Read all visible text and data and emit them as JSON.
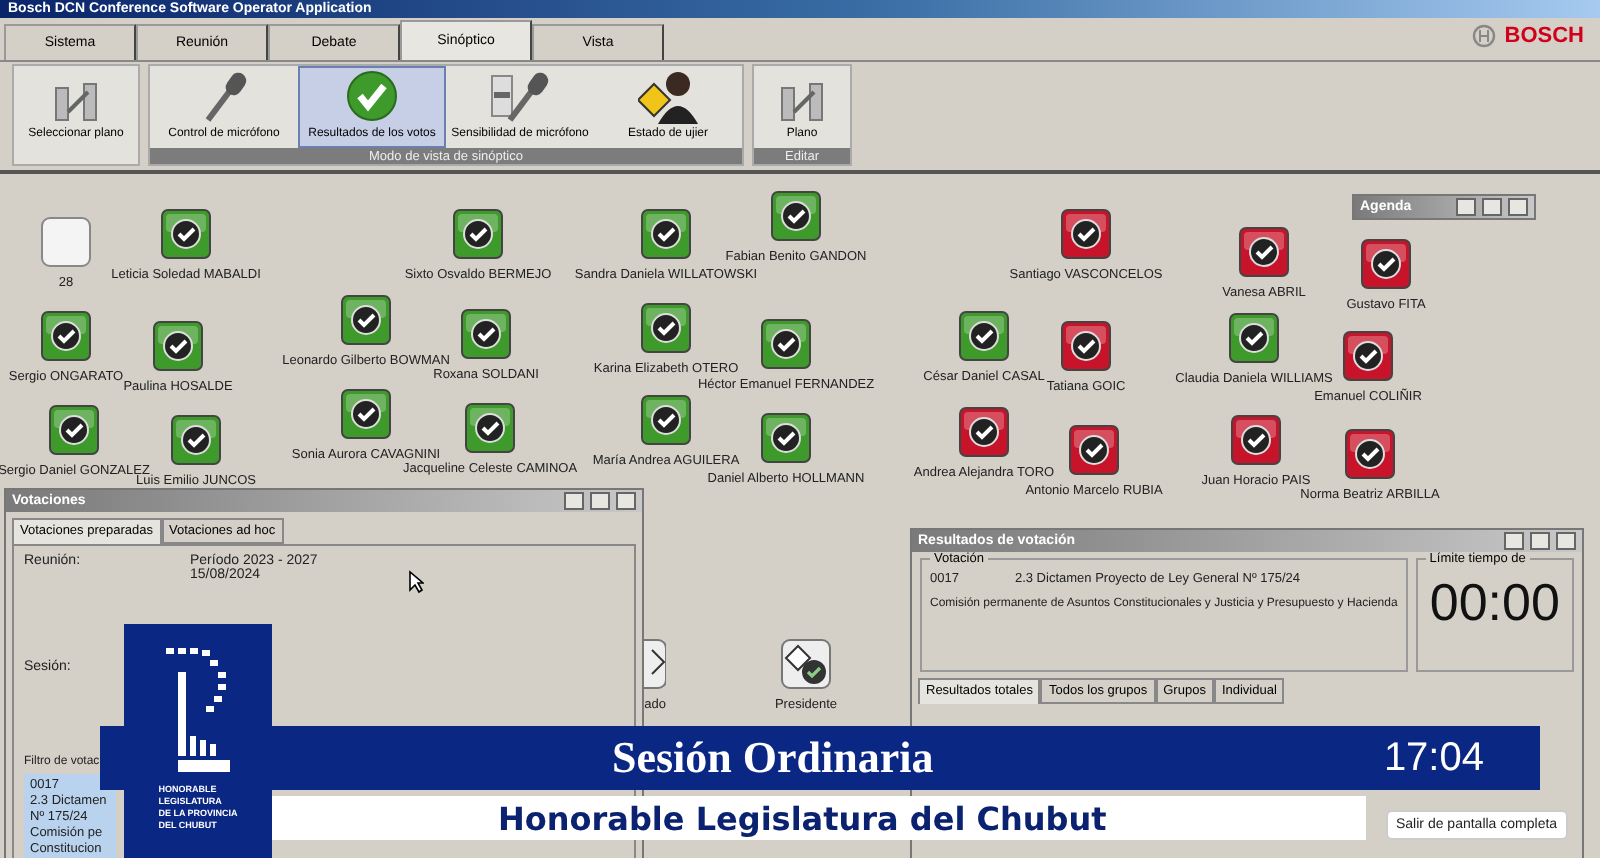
{
  "window": {
    "title": "Bosch DCN Conference Software Operator Application",
    "brand": "BOSCH"
  },
  "tabs": [
    {
      "label": "Sistema",
      "selected": false
    },
    {
      "label": "Reunión",
      "selected": false
    },
    {
      "label": "Debate",
      "selected": false
    },
    {
      "label": "Sinóptico",
      "selected": true
    },
    {
      "label": "Vista",
      "selected": false
    }
  ],
  "ribbon": {
    "plan_selector": {
      "label": "Seleccionar plano"
    },
    "groups": [
      {
        "label": "Modo de vista de sinóptico",
        "buttons": [
          {
            "label": "Control de micrófono",
            "kind": "microphone",
            "selected": false
          },
          {
            "label": "Resultados de los votos",
            "kind": "check",
            "selected": true
          },
          {
            "label": "Sensibilidad de micrófono",
            "kind": "sensitivity",
            "selected": false
          },
          {
            "label": "Estado de ujier",
            "kind": "usher",
            "selected": false
          }
        ]
      },
      {
        "label": "Editar",
        "buttons": [
          {
            "label": "Plano",
            "kind": "plan",
            "selected": false
          }
        ]
      }
    ]
  },
  "seats": [
    {
      "label": "28",
      "kind": "empty"
    },
    {
      "label": "Leticia Soledad MABALDI",
      "kind": "vote",
      "color": "#3e9a2a"
    },
    {
      "label": "Sixto Osvaldo BERMEJO",
      "kind": "vote",
      "color": "#3e9a2a"
    },
    {
      "label": "Sandra Daniela WILLATOWSKI",
      "kind": "vote",
      "color": "#3e9a2a"
    },
    {
      "label": "Fabian Benito GANDON",
      "kind": "vote",
      "color": "#3e9a2a"
    },
    {
      "label": "Santiago VASCONCELOS",
      "kind": "vote",
      "color": "#c8142a"
    },
    {
      "label": "Vanesa ABRIL",
      "kind": "vote",
      "color": "#c8142a"
    },
    {
      "label": "Gustavo FITA",
      "kind": "vote",
      "color": "#c8142a"
    },
    {
      "label": "Sergio ONGARATO",
      "kind": "vote",
      "color": "#3e9a2a"
    },
    {
      "label": "Paulina HOSALDE",
      "kind": "vote",
      "color": "#3e9a2a"
    },
    {
      "label": "Leonardo Gilberto BOWMAN",
      "kind": "vote",
      "color": "#3e9a2a"
    },
    {
      "label": "Roxana SOLDANI",
      "kind": "vote",
      "color": "#3e9a2a"
    },
    {
      "label": "Karina Elizabeth OTERO",
      "kind": "vote",
      "color": "#3e9a2a"
    },
    {
      "label": "Héctor Emanuel FERNANDEZ",
      "kind": "vote",
      "color": "#3e9a2a"
    },
    {
      "label": "César Daniel CASAL",
      "kind": "vote",
      "color": "#3e9a2a"
    },
    {
      "label": "Tatiana GOIC",
      "kind": "vote",
      "color": "#c8142a"
    },
    {
      "label": "Claudia Daniela WILLIAMS",
      "kind": "vote",
      "color": "#3e9a2a"
    },
    {
      "label": "Emanuel COLIÑIR",
      "kind": "vote",
      "color": "#c8142a"
    },
    {
      "label": "Sergio Daniel GONZALEZ",
      "kind": "vote",
      "color": "#3e9a2a"
    },
    {
      "label": "Luis Emilio JUNCOS",
      "kind": "vote",
      "color": "#3e9a2a"
    },
    {
      "label": "Sonia Aurora CAVAGNINI",
      "kind": "vote",
      "color": "#3e9a2a"
    },
    {
      "label": "Jacqueline Celeste CAMINOA",
      "kind": "vote",
      "color": "#3e9a2a"
    },
    {
      "label": "María Andrea AGUILERA",
      "kind": "vote",
      "color": "#3e9a2a"
    },
    {
      "label": "Daniel Alberto HOLLMANN",
      "kind": "vote",
      "color": "#3e9a2a"
    },
    {
      "label": "Andrea Alejandra TORO",
      "kind": "vote",
      "color": "#c8142a"
    },
    {
      "label": "Antonio Marcelo RUBIA",
      "kind": "vote",
      "color": "#c8142a"
    },
    {
      "label": "Juan Horacio PAIS",
      "kind": "vote",
      "color": "#c8142a"
    },
    {
      "label": "Norma Beatriz ARBILLA",
      "kind": "vote",
      "color": "#c8142a"
    },
    {
      "label": "ado",
      "kind": "partial"
    },
    {
      "label": "Presidente",
      "kind": "president"
    }
  ],
  "agenda_window": {
    "title": "Agenda"
  },
  "votaciones_window": {
    "title": "Votaciones",
    "tabs": [
      {
        "label": "Votaciones preparadas",
        "selected": true
      },
      {
        "label": "Votaciones ad hoc",
        "selected": false
      }
    ],
    "fields": [
      {
        "label": "Reunión:",
        "lines": [
          "Período 2023 - 2027",
          "15/08/2024"
        ]
      },
      {
        "label": "Sesión:"
      }
    ],
    "filter_label": "Filtro de votac",
    "list_item": [
      "0017",
      "2.3 Dictamen",
      "Nº 175/24",
      "Comisión pe",
      "Constitucion"
    ]
  },
  "results_window": {
    "title": "Resultados de votación",
    "vote_group": {
      "label": "Votación",
      "number": "0017",
      "title": "2.3 Dictamen Proyecto de Ley General Nº 175/24",
      "description": "Comisión permanente de Asuntos Constitucionales y Justicia y Presupuesto y Hacienda"
    },
    "time_group": {
      "label": "Límite tiempo de",
      "time": "00:00"
    },
    "tabs": [
      {
        "label": "Resultados totales",
        "selected": true
      },
      {
        "label": "Todos los grupos",
        "selected": false
      },
      {
        "label": "Grupos",
        "selected": false
      },
      {
        "label": "Individual",
        "selected": false
      }
    ]
  },
  "overlay": {
    "session": "Sesión Ordinaria",
    "clock": "17:04",
    "subtitle": "Honorable Legislatura del Chubut",
    "logo_lines": [
      "HONORABLE",
      "LEGISLATURA",
      "DE LA PROVINCIA",
      "DEL CHUBUT"
    ]
  },
  "tooltip": "Salir de pantalla completa"
}
